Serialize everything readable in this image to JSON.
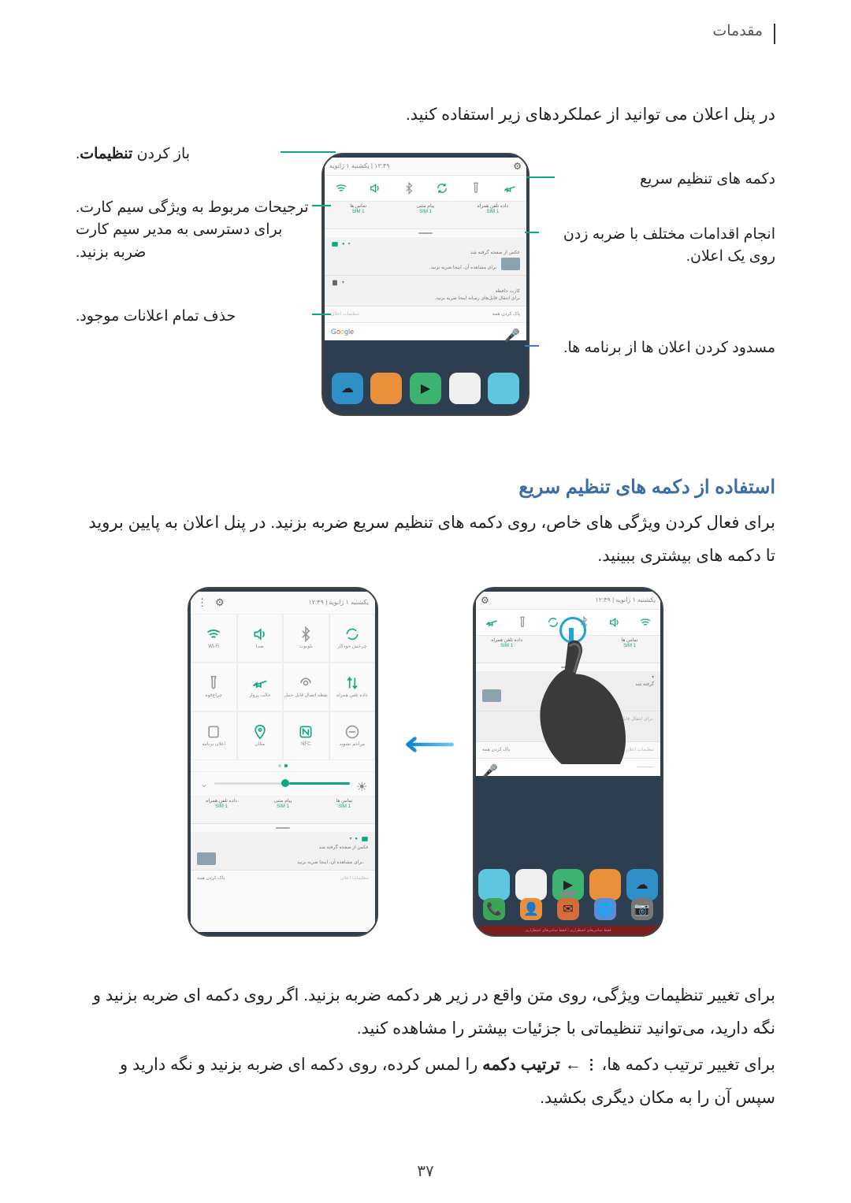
{
  "header": "مقدمات",
  "intro": "در پنل اعلان می توانید از عملکردهای زیر استفاده کنید.",
  "fig1": {
    "callouts": {
      "open_settings": "باز کردن <b>تنظیمات</b>.",
      "quick_buttons": "دکمه های تنظیم سریع",
      "sim_prefs": "ترجیحات مربوط به ویژگی سیم کارت. برای دسترسی به مدیر سیم کارت ضربه بزنید.",
      "notif_action": "انجام اقدامات مختلف با ضربه زدن روی یک اعلان.",
      "clear_all": "حذف تمام اعلانات موجود.",
      "block_apps": "مسدود کردن اعلان ها از برنامه ها."
    },
    "panel": {
      "time_carrier": "۱۲:۴۹ | یکشنبه ۱ ژانویه",
      "sim_labels": [
        "تماس ها",
        "پیام متنی",
        "داده تلفن همراه"
      ],
      "sim_badge": "SIM 1",
      "notif1": {
        "title": "عکس از صفحه گرفته شد",
        "sub": "برای مشاهده آن، اینجا ضربه بزنید."
      },
      "notif2": {
        "title": "کارت حافظه",
        "sub": "برای انتقال فایل‌های رسانه اینجا ضربه بزنید."
      },
      "clear_label": "پاک کردن همه",
      "settings_label": "تنظیمات اعلان",
      "google": "Google"
    }
  },
  "section2": {
    "heading": "استفاده از دکمه های تنظیم سریع",
    "para1": "برای فعال کردن ویژگی های خاص، روی دکمه های تنظیم سریع ضربه بزنید. در پنل اعلان به پایین بروید تا دکمه های بیشتری ببینید.",
    "para_feature": "برای تغییر تنظیمات ویژگی، روی متن واقع در زیر هر دکمه ضربه بزنید. اگر روی دکمه ای ضربه بزنید و نگه دارید، می‌توانید تنظیماتی با جزئیات بیشتر را مشاهده کنید.",
    "para_order_pre": "برای تغییر ترتیب دکمه ها، ",
    "para_order_mid": " ← <b>ترتیب دکمه</b> را لمس کرده، روی دکمه ای ضربه بزنید و نگه دارید و سپس آن را به مکان دیگری بکشید."
  },
  "fig2": {
    "exp": {
      "time": "۱۲:۴۹ | یکشنبه ۱ ژانویه",
      "cells": [
        {
          "name": "wifi",
          "label": "Wi-Fi"
        },
        {
          "name": "sound",
          "label": "صدا"
        },
        {
          "name": "bluetooth",
          "label": "بلوتوث"
        },
        {
          "name": "rotate-lock",
          "label": "چرخش خودکار"
        },
        {
          "name": "flashlight",
          "label": "چراغ‌قوه"
        },
        {
          "name": "airplane",
          "label": "حالت پرواز"
        },
        {
          "name": "hotspot",
          "label": "نقطه اتصال قابل حمل"
        },
        {
          "name": "mobile-data",
          "label": "داده تلفن همراه"
        },
        {
          "name": "read",
          "label": "اعلان برنامه"
        },
        {
          "name": "location",
          "label": "مکان"
        },
        {
          "name": "nfc",
          "label": "NFC"
        },
        {
          "name": "dnd",
          "label": "مزاحم نشوید"
        }
      ]
    },
    "shade": {
      "sim_labels": [
        "تماس ها",
        "پیام متنی",
        "داده تلفن همراه"
      ],
      "notif1_title": "گرفته شد",
      "clear": "پاک کردن همه",
      "settings_lbl": "تنظیمات اعلان"
    },
    "redbar": "فقط تماس‌های اضطراری | فقط تماس‌های اضطراری"
  },
  "page_number": "۳۷"
}
